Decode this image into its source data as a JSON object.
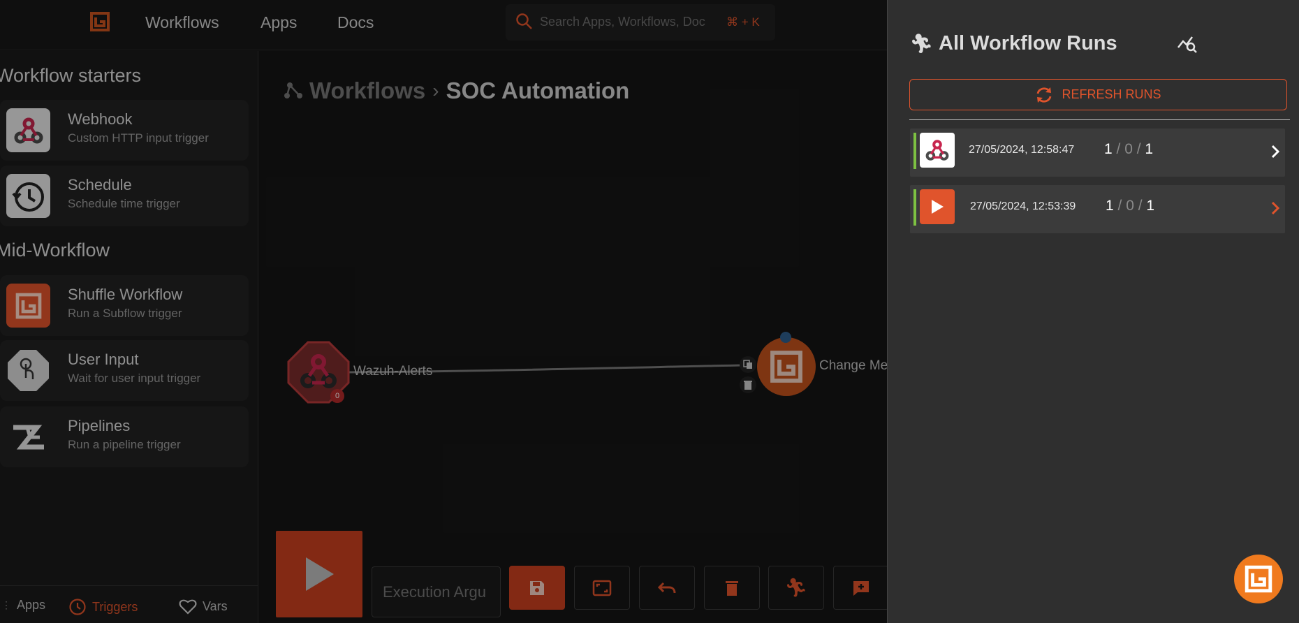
{
  "topbar": {
    "nav": [
      "Workflows",
      "Apps",
      "Docs"
    ],
    "search_placeholder": "Search Apps, Workflows, Doc",
    "search_shortcut": "⌘ + K"
  },
  "sidebar": {
    "section_starters": "Workflow starters",
    "section_mid": "Mid-Workflow",
    "triggers": [
      {
        "name": "Webhook",
        "desc": "Custom HTTP input trigger"
      },
      {
        "name": "Schedule",
        "desc": "Schedule time trigger"
      },
      {
        "name": "Shuffle Workflow",
        "desc": "Run a Subflow trigger"
      },
      {
        "name": "User Input",
        "desc": "Wait for user input trigger"
      },
      {
        "name": "Pipelines",
        "desc": "Run a pipeline trigger"
      }
    ],
    "tabs": [
      "Apps",
      "Triggers",
      "Vars"
    ],
    "active_tab": "Triggers"
  },
  "canvas": {
    "breadcrumb_root": "Workflows",
    "breadcrumb_sep": "›",
    "workflow_name": "SOC Automation",
    "nodes": [
      {
        "label": "Wazuh-Alerts",
        "badge": "0"
      },
      {
        "label": "Change Me"
      }
    ],
    "exec_args_placeholder": "Execution Argu"
  },
  "drawer": {
    "title": "All Workflow Runs",
    "refresh_label": "REFRESH RUNS",
    "runs": [
      {
        "icon": "webhook-icon",
        "time": "27/05/2024, 12:58:47",
        "success": "1",
        "failed": "0",
        "total": "1"
      },
      {
        "icon": "play-icon",
        "time": "27/05/2024, 12:53:39",
        "success": "1",
        "failed": "0",
        "total": "1"
      }
    ]
  },
  "colors": {
    "accent": "#e0542c",
    "success_bar": "#7ec242",
    "fab": "#f07a1e"
  }
}
